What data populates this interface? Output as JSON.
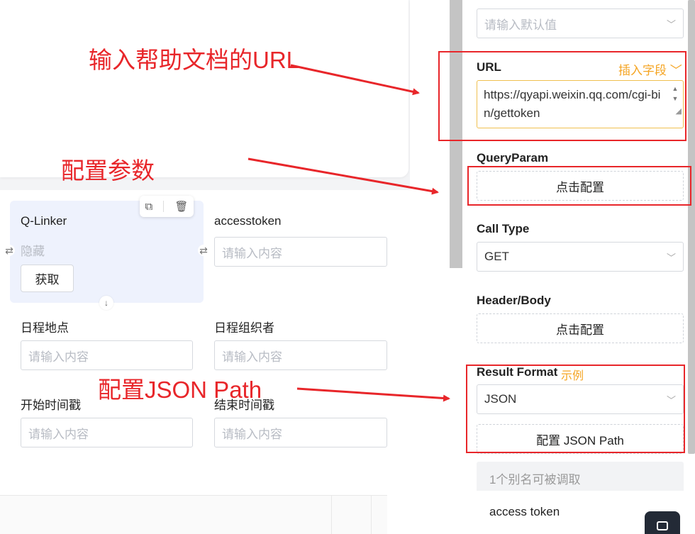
{
  "canvas": {
    "qlinker": {
      "title": "Q-Linker",
      "hidden_text": "隐藏",
      "fetch_label": "获取",
      "tools": {
        "copy_icon": "copy-icon",
        "delete_icon": "trash-icon"
      }
    },
    "fields": [
      {
        "label": "accesstoken",
        "placeholder": "请输入内容"
      },
      {
        "label": "日程地点",
        "placeholder": "请输入内容"
      },
      {
        "label": "日程组织者",
        "placeholder": "请输入内容"
      },
      {
        "label": "开始时间戳",
        "placeholder": "请输入内容"
      },
      {
        "label": "结束时间戳",
        "placeholder": "请输入内容"
      }
    ]
  },
  "panel": {
    "default_value": {
      "placeholder": "请输入默认值"
    },
    "url": {
      "label": "URL",
      "insert_field": "插入字段",
      "value": "https://qyapi.weixin.qq.com/cgi-bin/gettoken"
    },
    "query_param": {
      "label": "QueryParam",
      "button": "点击配置"
    },
    "call_type": {
      "label": "Call Type",
      "value": "GET"
    },
    "header_body": {
      "label": "Header/Body",
      "button": "点击配置"
    },
    "result_format": {
      "label": "Result Format",
      "example": "示例",
      "value": "JSON",
      "json_path_button": "配置 JSON Path"
    },
    "alias": {
      "header": "1个别名可被调取",
      "items": [
        "access token"
      ]
    }
  },
  "annotations": {
    "url_help": "输入帮助文档的URL",
    "config_params": "配置参数",
    "config_json_path": "配置JSON Path"
  },
  "colors": {
    "accent": "#f5a524",
    "annotation": "#e8262a",
    "qlinker_bg": "#eef2fd"
  }
}
